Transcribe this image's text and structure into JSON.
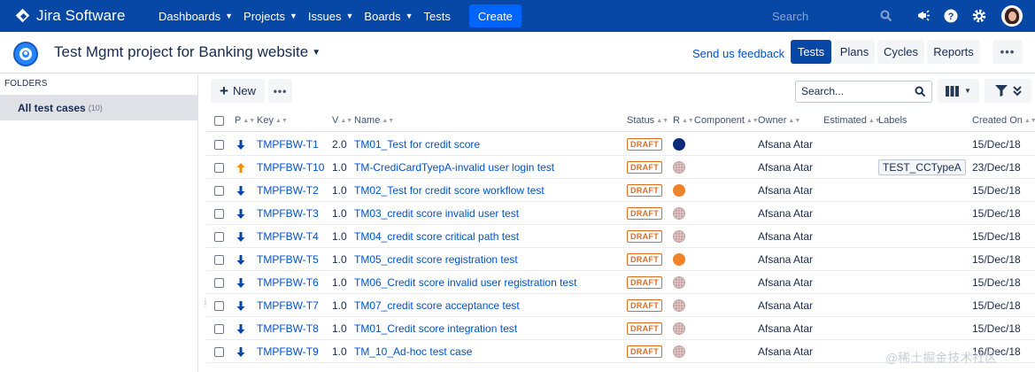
{
  "topnav": {
    "logo_text": "Jira Software",
    "items": [
      {
        "label": "Dashboards",
        "dropdown": true
      },
      {
        "label": "Projects",
        "dropdown": true
      },
      {
        "label": "Issues",
        "dropdown": true
      },
      {
        "label": "Boards",
        "dropdown": true
      },
      {
        "label": "Tests",
        "dropdown": false
      }
    ],
    "create_label": "Create",
    "search_placeholder": "Search"
  },
  "project": {
    "title": "Test Mgmt project for Banking website",
    "feedback_label": "Send us feedback",
    "tabs": [
      {
        "label": "Tests",
        "active": true
      },
      {
        "label": "Plans",
        "active": false
      },
      {
        "label": "Cycles",
        "active": false
      },
      {
        "label": "Reports",
        "active": false
      }
    ],
    "more_label": "•••"
  },
  "sidebar": {
    "folders_label": "FOLDERS",
    "folder": {
      "name": "All test cases",
      "count": "(10)"
    }
  },
  "toolbar": {
    "new_label": "New",
    "more_label": "•••",
    "search_placeholder": "Search..."
  },
  "table": {
    "headers": {
      "p": "P",
      "key": "Key",
      "v": "V",
      "name": "Name",
      "status": "Status",
      "r": "R",
      "component": "Component",
      "owner": "Owner",
      "estimated": "Estimated",
      "labels": "Labels",
      "created": "Created On"
    },
    "rows": [
      {
        "priority": "low",
        "key": "TMPFBW-T1",
        "version": "2.0",
        "name": "TM01_Test for credit score",
        "status": "DRAFT",
        "result": "navy",
        "component": "",
        "owner": "Afsana Atar",
        "estimated": "",
        "label": "",
        "created": "15/Dec/18"
      },
      {
        "priority": "high",
        "key": "TMPFBW-T10",
        "version": "1.0",
        "name": "TM-CrediCardTyepA-invalid user login test",
        "status": "DRAFT",
        "result": "pending",
        "component": "",
        "owner": "Afsana Atar",
        "estimated": "",
        "label": "TEST_CCTypeA",
        "created": "23/Dec/18"
      },
      {
        "priority": "low",
        "key": "TMPFBW-T2",
        "version": "1.0",
        "name": "TM02_Test for credit score workflow test",
        "status": "DRAFT",
        "result": "orange",
        "component": "",
        "owner": "Afsana Atar",
        "estimated": "",
        "label": "",
        "created": "15/Dec/18"
      },
      {
        "priority": "low",
        "key": "TMPFBW-T3",
        "version": "1.0",
        "name": "TM03_credit score invalid user test",
        "status": "DRAFT",
        "result": "pending",
        "component": "",
        "owner": "Afsana Atar",
        "estimated": "",
        "label": "",
        "created": "15/Dec/18"
      },
      {
        "priority": "low",
        "key": "TMPFBW-T4",
        "version": "1.0",
        "name": "TM04_credit score critical path test",
        "status": "DRAFT",
        "result": "pending",
        "component": "",
        "owner": "Afsana Atar",
        "estimated": "",
        "label": "",
        "created": "15/Dec/18"
      },
      {
        "priority": "low",
        "key": "TMPFBW-T5",
        "version": "1.0",
        "name": "TM05_credit score registration test",
        "status": "DRAFT",
        "result": "orange",
        "component": "",
        "owner": "Afsana Atar",
        "estimated": "",
        "label": "",
        "created": "15/Dec/18"
      },
      {
        "priority": "low",
        "key": "TMPFBW-T6",
        "version": "1.0",
        "name": "TM06_Credit score invalid user registration test",
        "status": "DRAFT",
        "result": "pending",
        "component": "",
        "owner": "Afsana Atar",
        "estimated": "",
        "label": "",
        "created": "15/Dec/18"
      },
      {
        "priority": "low",
        "key": "TMPFBW-T7",
        "version": "1.0",
        "name": "TM07_credit score acceptance test",
        "status": "DRAFT",
        "result": "pending",
        "component": "",
        "owner": "Afsana Atar",
        "estimated": "",
        "label": "",
        "created": "15/Dec/18"
      },
      {
        "priority": "low",
        "key": "TMPFBW-T8",
        "version": "1.0",
        "name": "TM01_Credit score integration test",
        "status": "DRAFT",
        "result": "pending",
        "component": "",
        "owner": "Afsana Atar",
        "estimated": "",
        "label": "",
        "created": "15/Dec/18"
      },
      {
        "priority": "low",
        "key": "TMPFBW-T9",
        "version": "1.0",
        "name": "TM_10_Ad-hoc test case",
        "status": "DRAFT",
        "result": "pending",
        "component": "",
        "owner": "Afsana Atar",
        "estimated": "",
        "label": "",
        "created": "16/Dec/18"
      }
    ]
  },
  "watermark": "@稀土掘金技术社区",
  "colors": {
    "nav_bg": "#0747a6",
    "create_bg": "#0065ff",
    "link": "#0052cc",
    "draft": "#de6b1e",
    "priority_low": "#0747a6",
    "priority_high": "#ff8b00",
    "result_navy": "#0b2a7a",
    "result_orange": "#f0832a"
  },
  "icons": {
    "notifications": "megaphone-icon",
    "help": "help-icon",
    "settings": "gear-icon",
    "search": "search-icon"
  }
}
